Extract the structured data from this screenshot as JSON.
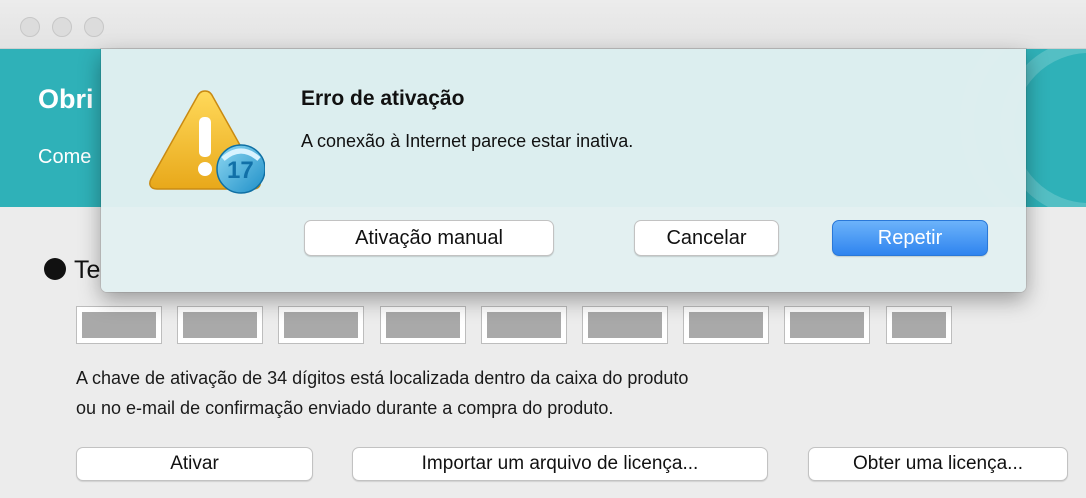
{
  "window": {
    "traffic_lights": [
      "close",
      "minimize",
      "zoom"
    ]
  },
  "banner": {
    "title": "Obri",
    "subtitle": "Come",
    "color": "#2fb1b8"
  },
  "activation": {
    "option_label": "Te",
    "key_box_count": 9,
    "hint_line1": "A chave de ativação de 34 dígitos está localizada dentro da caixa do produto",
    "hint_line2": "ou no e-mail de confirmação enviado durante a compra do produto.",
    "buttons": {
      "activate": "Ativar",
      "import": "Importar um arquivo de licença...",
      "get_license": "Obter uma licença..."
    }
  },
  "dialog": {
    "title": "Erro de ativação",
    "message": "A conexão à Internet parece estar inativa.",
    "icon": "warning-icon",
    "badge": "17",
    "buttons": {
      "manual": "Ativação manual",
      "cancel": "Cancelar",
      "retry": "Repetir"
    },
    "accent": "#2f84ef"
  }
}
